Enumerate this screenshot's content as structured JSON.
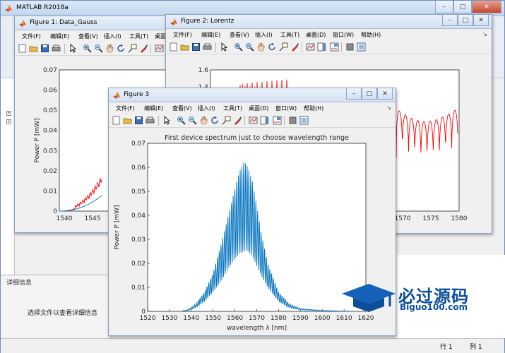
{
  "app": {
    "title": "MATLAB R2018a",
    "details_panel_title": "详细信息",
    "details_hint": "选择文件以查看详细信息",
    "status_row": "行 1",
    "status_col": "列 1"
  },
  "menus": [
    "文件(F)",
    "编辑(E)",
    "查看(V)",
    "插入(I)",
    "工具(T)",
    "桌面(D)",
    "窗口(W)",
    "帮助(H)"
  ],
  "toolbar_icons": [
    "new-figure-icon",
    "open-file-icon",
    "save-figure-icon",
    "print-figure-icon",
    "edit-plot-icon",
    "zoom-in-icon",
    "zoom-out-icon",
    "pan-icon",
    "rotate-3d-icon",
    "data-cursor-icon",
    "brush-icon",
    "link-plot-icon",
    "insert-colorbar-icon",
    "insert-legend-icon",
    "hide-plot-tools-icon",
    "show-plot-tools-icon"
  ],
  "figures": [
    {
      "title": "Figure 1: Data_Gauss",
      "axis_ylabel": "Power P [mW]",
      "yticks": [
        "0.07",
        "0.06",
        "0.05",
        "0.04",
        "0.03",
        "0.02",
        "0.01",
        "0"
      ],
      "xticks": [
        "1540",
        "1545"
      ]
    },
    {
      "title": "Figure 2: Lorentz",
      "yticks": [
        "1.6",
        "1.4"
      ],
      "xticks": [
        "1570",
        "1575",
        "1580"
      ]
    },
    {
      "title": "Figure 3",
      "chart_data": {
        "type": "line",
        "title": "First device spectrum just to choose wavelength range",
        "xlabel": "wavelength λ [nm]",
        "ylabel": "Power P [mW]",
        "xlim": [
          1520,
          1620
        ],
        "ylim": [
          0,
          0.07
        ],
        "xticks": [
          "1520",
          "1530",
          "1540",
          "1550",
          "1560",
          "1570",
          "1580",
          "1590",
          "1600",
          "1610",
          "1620"
        ],
        "yticks": [
          "0",
          "0.01",
          "0.02",
          "0.03",
          "0.04",
          "0.05",
          "0.06",
          "0.07"
        ],
        "series": [
          {
            "color": "#0072bd",
            "envelope_upper": {
              "x": [
                1538,
                1542,
                1546,
                1550,
                1554,
                1557,
                1560,
                1562,
                1564,
                1565,
                1566,
                1568,
                1570,
                1572,
                1575,
                1580,
                1585,
                1590,
                1600,
                1610
              ],
              "y": [
                0.0005,
                0.003,
                0.008,
                0.016,
                0.029,
                0.04,
                0.051,
                0.058,
                0.062,
                0.0615,
                0.06,
                0.054,
                0.044,
                0.033,
                0.02,
                0.008,
                0.003,
                0.0012,
                0.0004,
                0.0001
              ]
            },
            "envelope_lower": {
              "x": [
                1538,
                1542,
                1546,
                1550,
                1554,
                1557,
                1560,
                1562,
                1564,
                1565,
                1566,
                1568,
                1570,
                1572,
                1575,
                1580,
                1585,
                1590,
                1600,
                1610
              ],
              "y": [
                0.0002,
                0.0015,
                0.004,
                0.008,
                0.013,
                0.018,
                0.022,
                0.024,
                0.025,
                0.0255,
                0.025,
                0.023,
                0.019,
                0.015,
                0.01,
                0.004,
                0.0015,
                0.0006,
                0.0002,
                5e-05
              ]
            },
            "oscillation_period_nm": 0.8
          }
        ]
      }
    }
  ],
  "watermark": {
    "brand": "必过源码",
    "url": "Biguo100.com"
  },
  "colors": {
    "figure_bg": "#f0f0f0",
    "line_blue": "#0072bd",
    "line_red": "#ff0000",
    "titlebar": "#dbe8f7"
  }
}
